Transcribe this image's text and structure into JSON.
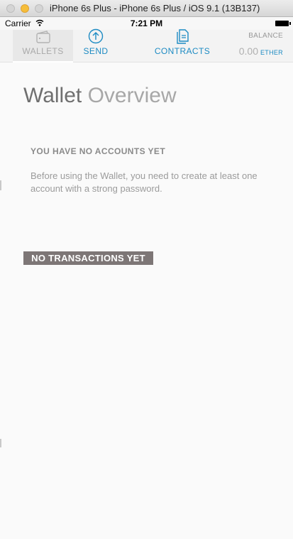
{
  "window": {
    "title": "iPhone 6s Plus - iPhone 6s Plus / iOS 9.1 (13B137)"
  },
  "status_bar": {
    "carrier": "Carrier",
    "time": "7:21 PM"
  },
  "nav": {
    "items": [
      {
        "label": "WALLETS",
        "icon": "wallet-icon",
        "active": true
      },
      {
        "label": "SEND",
        "icon": "arrow-up-circle-icon"
      },
      {
        "label": "CONTRACTS",
        "icon": "contracts-icon"
      }
    ],
    "balance": {
      "label": "BALANCE",
      "amount": "0.00",
      "unit": "ETHER"
    }
  },
  "main": {
    "title_strong": "Wallet",
    "title_light": "Overview",
    "no_accounts_heading": "YOU HAVE NO ACCOUNTS YET",
    "no_accounts_text": "Before using the Wallet, you need to create at least one account with a strong password.",
    "no_transactions": "NO TRANSACTIONS YET"
  },
  "colors": {
    "accent": "#1d8bc3",
    "window_min": "#f6be3a",
    "badge_bg": "#7d7676"
  }
}
